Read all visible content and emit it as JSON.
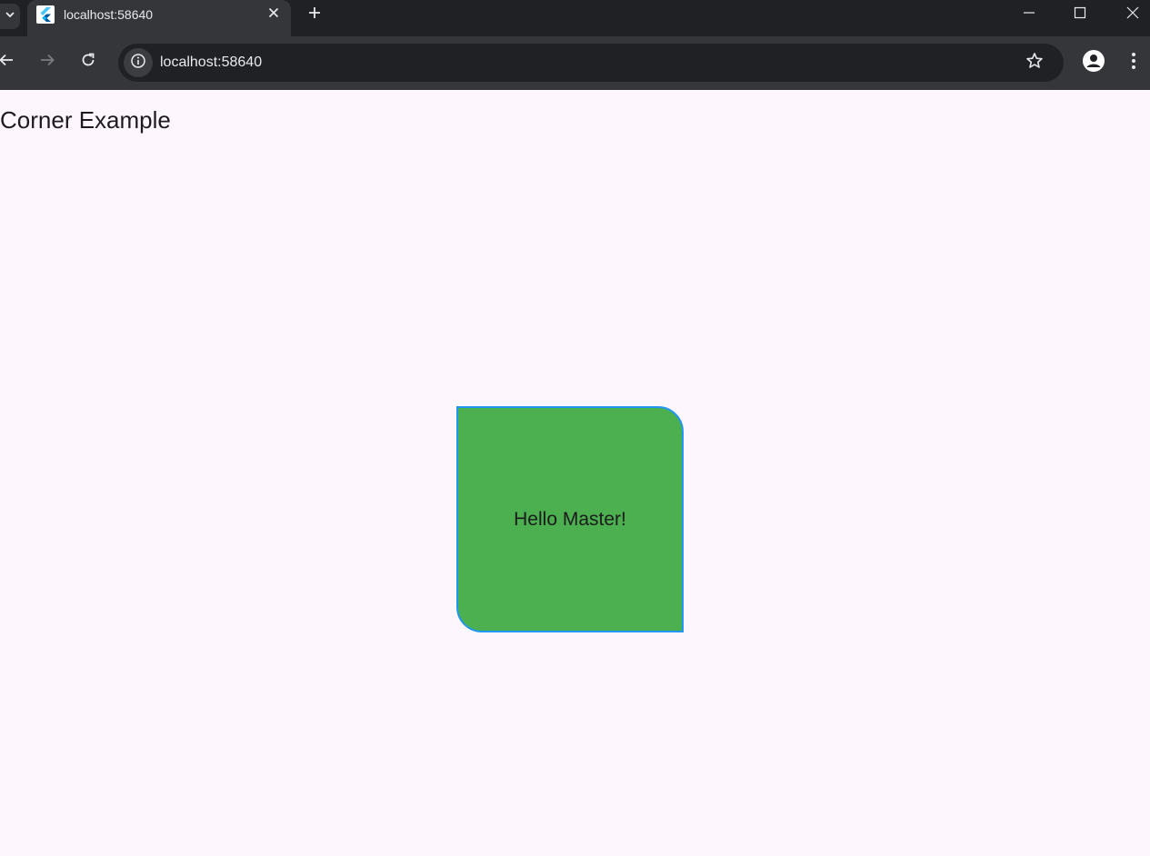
{
  "browser": {
    "tab": {
      "title": "localhost:58640",
      "favicon": "flutter-logo-icon"
    },
    "address_bar": {
      "url": "localhost:58640"
    },
    "icons": {
      "tab_list": "chevron-down-icon",
      "tab_close": "close-icon",
      "new_tab": "plus-icon",
      "minimize": "minimize-icon",
      "maximize": "maximize-icon",
      "close_window": "close-icon",
      "back": "arrow-left-icon",
      "forward": "arrow-right-icon",
      "reload": "reload-icon",
      "site_info": "info-icon",
      "bookmark": "star-icon",
      "profile": "account-icon",
      "menu": "more-vertical-icon"
    },
    "colors": {
      "titlebar": "#202124",
      "toolbar": "#35363a",
      "omnibox": "#202124",
      "text": "#e8eaed"
    }
  },
  "page": {
    "title": "Corner Example",
    "box": {
      "text": "Hello Master!",
      "fill_color": "#4caf50",
      "border_color": "#2196f3"
    },
    "background": "#fdf7fd"
  }
}
